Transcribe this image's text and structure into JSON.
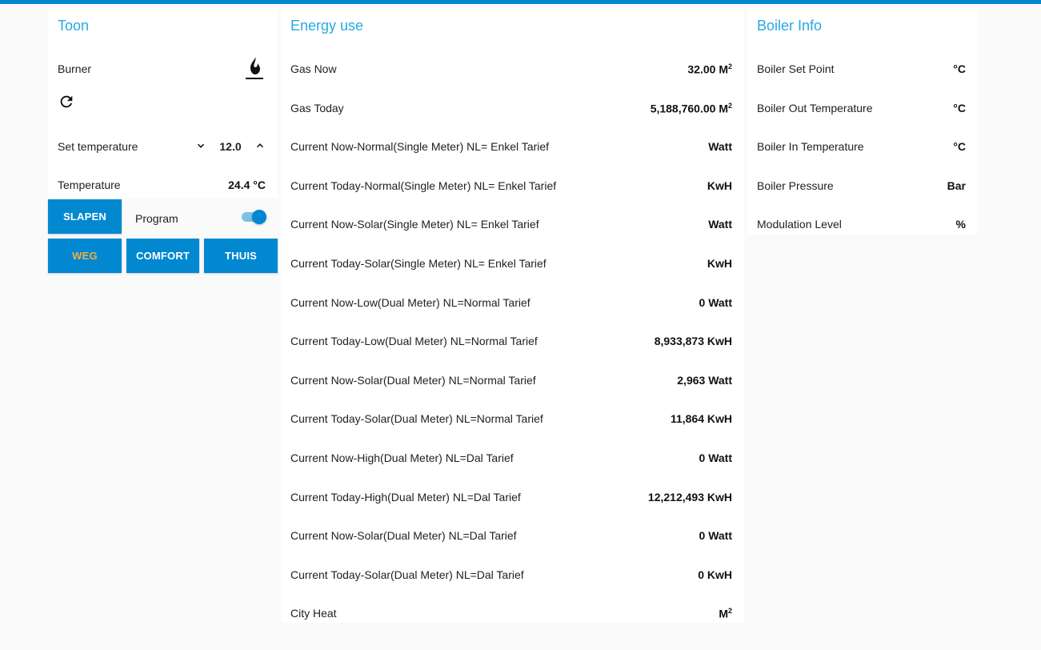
{
  "toon": {
    "title": "Toon",
    "burner_label": "Burner",
    "burner_icon": "flame-icon",
    "refresh_icon": "refresh-icon",
    "set_temperature_label": "Set temperature",
    "set_temperature_value": "12.0",
    "temperature_label": "Temperature",
    "temperature_value": "24.4 °C",
    "program_label": "Program",
    "program_enabled": true,
    "buttons": {
      "slapen": "SLAPEN",
      "weg": "WEG",
      "comfort": "COMFORT",
      "thuis": "THUIS"
    },
    "accent_color": "#0288d1",
    "active_text_color": "#f0b040"
  },
  "energy": {
    "title": "Energy use",
    "rows": [
      {
        "label": "Gas Now",
        "value": "32.00 M",
        "sup": "2"
      },
      {
        "label": "Gas Today",
        "value": "5,188,760.00 M",
        "sup": "2"
      },
      {
        "label": "Current Now-Normal(Single Meter) NL= Enkel Tarief",
        "value": "Watt",
        "sup": ""
      },
      {
        "label": "Current Today-Normal(Single Meter) NL= Enkel Tarief",
        "value": "KwH",
        "sup": ""
      },
      {
        "label": "Current Now-Solar(Single Meter) NL= Enkel Tarief",
        "value": "Watt",
        "sup": ""
      },
      {
        "label": "Current Today-Solar(Single Meter) NL= Enkel Tarief",
        "value": "KwH",
        "sup": ""
      },
      {
        "label": "Current Now-Low(Dual Meter) NL=Normal Tarief",
        "value": "0 Watt",
        "sup": ""
      },
      {
        "label": "Current Today-Low(Dual Meter) NL=Normal Tarief",
        "value": "8,933,873 KwH",
        "sup": ""
      },
      {
        "label": "Current Now-Solar(Dual Meter) NL=Normal Tarief",
        "value": "2,963 Watt",
        "sup": ""
      },
      {
        "label": "Current Today-Solar(Dual Meter) NL=Normal Tarief",
        "value": "11,864 KwH",
        "sup": ""
      },
      {
        "label": "Current Now-High(Dual Meter) NL=Dal Tarief",
        "value": "0 Watt",
        "sup": ""
      },
      {
        "label": "Current Today-High(Dual Meter) NL=Dal Tarief",
        "value": "12,212,493 KwH",
        "sup": ""
      },
      {
        "label": "Current Now-Solar(Dual Meter) NL=Dal Tarief",
        "value": "0 Watt",
        "sup": ""
      },
      {
        "label": "Current Today-Solar(Dual Meter) NL=Dal Tarief",
        "value": "0 KwH",
        "sup": ""
      },
      {
        "label": "City Heat",
        "value": "M",
        "sup": "2"
      }
    ]
  },
  "boiler": {
    "title": "Boiler Info",
    "rows": [
      {
        "label": "Boiler Set Point",
        "value": "°C"
      },
      {
        "label": "Boiler Out Temperature",
        "value": "°C"
      },
      {
        "label": "Boiler In Temperature",
        "value": "°C"
      },
      {
        "label": "Boiler Pressure",
        "value": "Bar"
      },
      {
        "label": "Modulation Level",
        "value": "%"
      }
    ]
  },
  "colors": {
    "header_bar": "#0288d1",
    "card_title": "#29a8e0",
    "background": "#fafafa"
  }
}
